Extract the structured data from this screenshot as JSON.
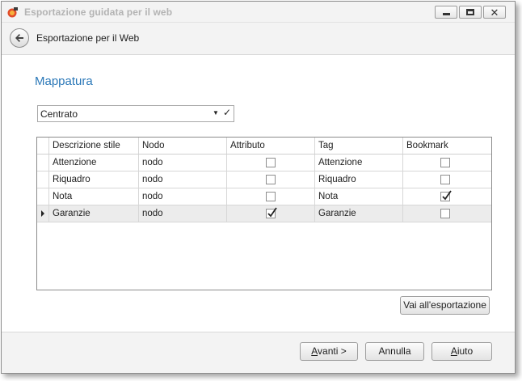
{
  "window": {
    "title": "Esportazione guidata per il web"
  },
  "header": {
    "title": "Esportazione per il Web"
  },
  "section": {
    "title": "Mappatura"
  },
  "combo": {
    "value": "Centrato"
  },
  "grid": {
    "columns": [
      "Descrizione stile",
      "Nodo",
      "Attributo",
      "Tag",
      "Bookmark"
    ],
    "rows": [
      {
        "descrizione": "Attenzione",
        "nodo": "nodo",
        "attributo": false,
        "tag": "Attenzione",
        "bookmark": false
      },
      {
        "descrizione": "Riquadro",
        "nodo": "nodo",
        "attributo": false,
        "tag": "Riquadro",
        "bookmark": false
      },
      {
        "descrizione": "Nota",
        "nodo": "nodo",
        "attributo": false,
        "tag": "Nota",
        "bookmark": true
      },
      {
        "descrizione": "Garanzie",
        "nodo": "nodo",
        "attributo": true,
        "tag": "Garanzie",
        "bookmark": false
      }
    ],
    "selected_row": 3
  },
  "buttons": {
    "export": "Vai all'esportazione",
    "next_prefix": "A",
    "next_rest": "vanti >",
    "cancel": "Annulla",
    "help_prefix": "A",
    "help_rest": "iuto"
  },
  "colors": {
    "accent": "#2b78b8",
    "chrome": "#f3f3f3"
  }
}
